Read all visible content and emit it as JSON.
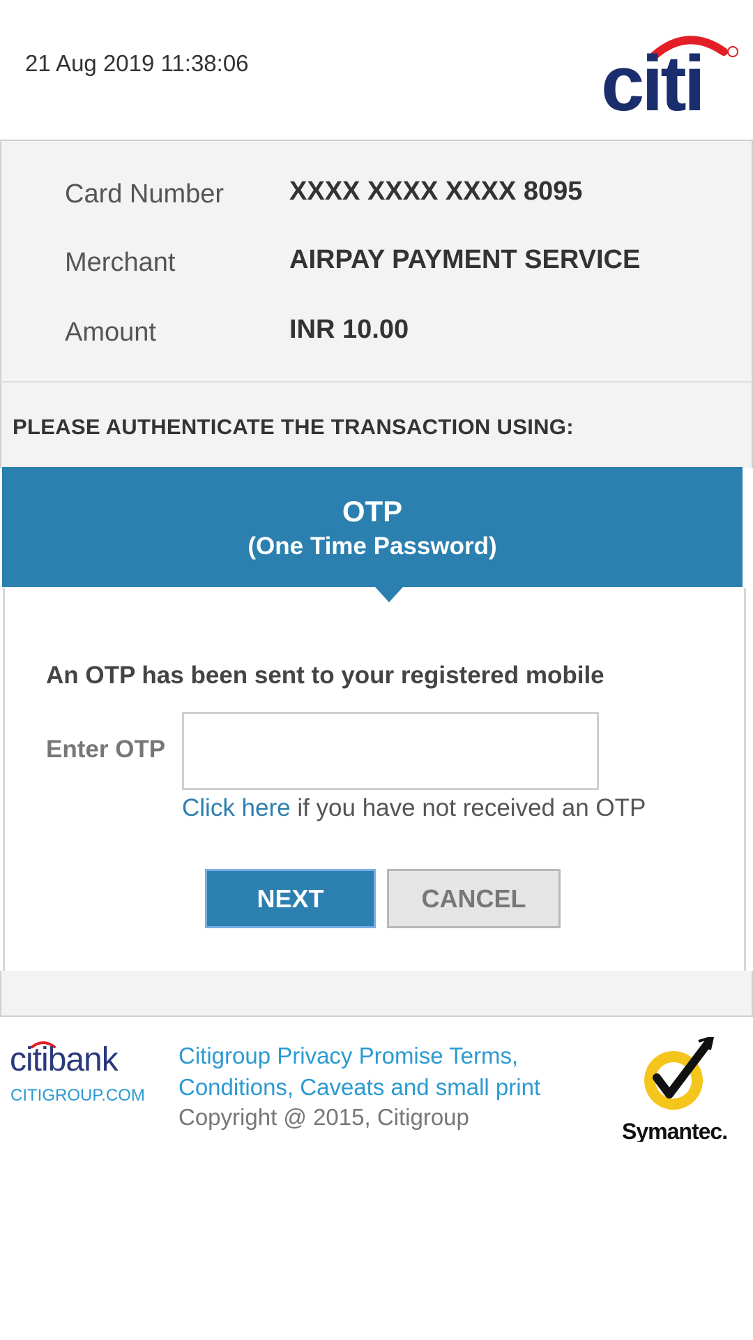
{
  "header": {
    "timestamp": "21 Aug 2019 11:38:06",
    "logo_text": "citi"
  },
  "transaction": {
    "rows": [
      {
        "label": "Card Number",
        "value": "XXXX XXXX XXXX 8095"
      },
      {
        "label": "Merchant",
        "value": "AIRPAY PAYMENT SERVICE"
      },
      {
        "label": "Amount",
        "value": "INR 10.00"
      }
    ]
  },
  "auth": {
    "instruction": "PLEASE AUTHENTICATE THE TRANSACTION USING:",
    "method_title": "OTP",
    "method_subtitle": "(One Time Password)",
    "sent_message": "An OTP has been sent to your registered mobile",
    "enter_label": "Enter OTP",
    "otp_value": "",
    "resend_link": "Click here",
    "resend_text": " if you have not received an OTP",
    "next_label": "NEXT",
    "cancel_label": "CANCEL"
  },
  "footer": {
    "citibank_logo_text": "citibank",
    "citigroup_link": "CITIGROUP.COM",
    "privacy_link": "Citigroup Privacy Promise Terms, Conditions, Caveats and small print",
    "copyright": "Copyright @ 2015, Citigroup",
    "symantec_logo_text": "Symantec."
  },
  "colors": {
    "primary_blue": "#2b80b0",
    "link_blue": "#2b9ad2",
    "citi_red": "#e31e26",
    "citi_navy": "#1a2d6d",
    "symantec_yellow": "#f6c51b"
  }
}
